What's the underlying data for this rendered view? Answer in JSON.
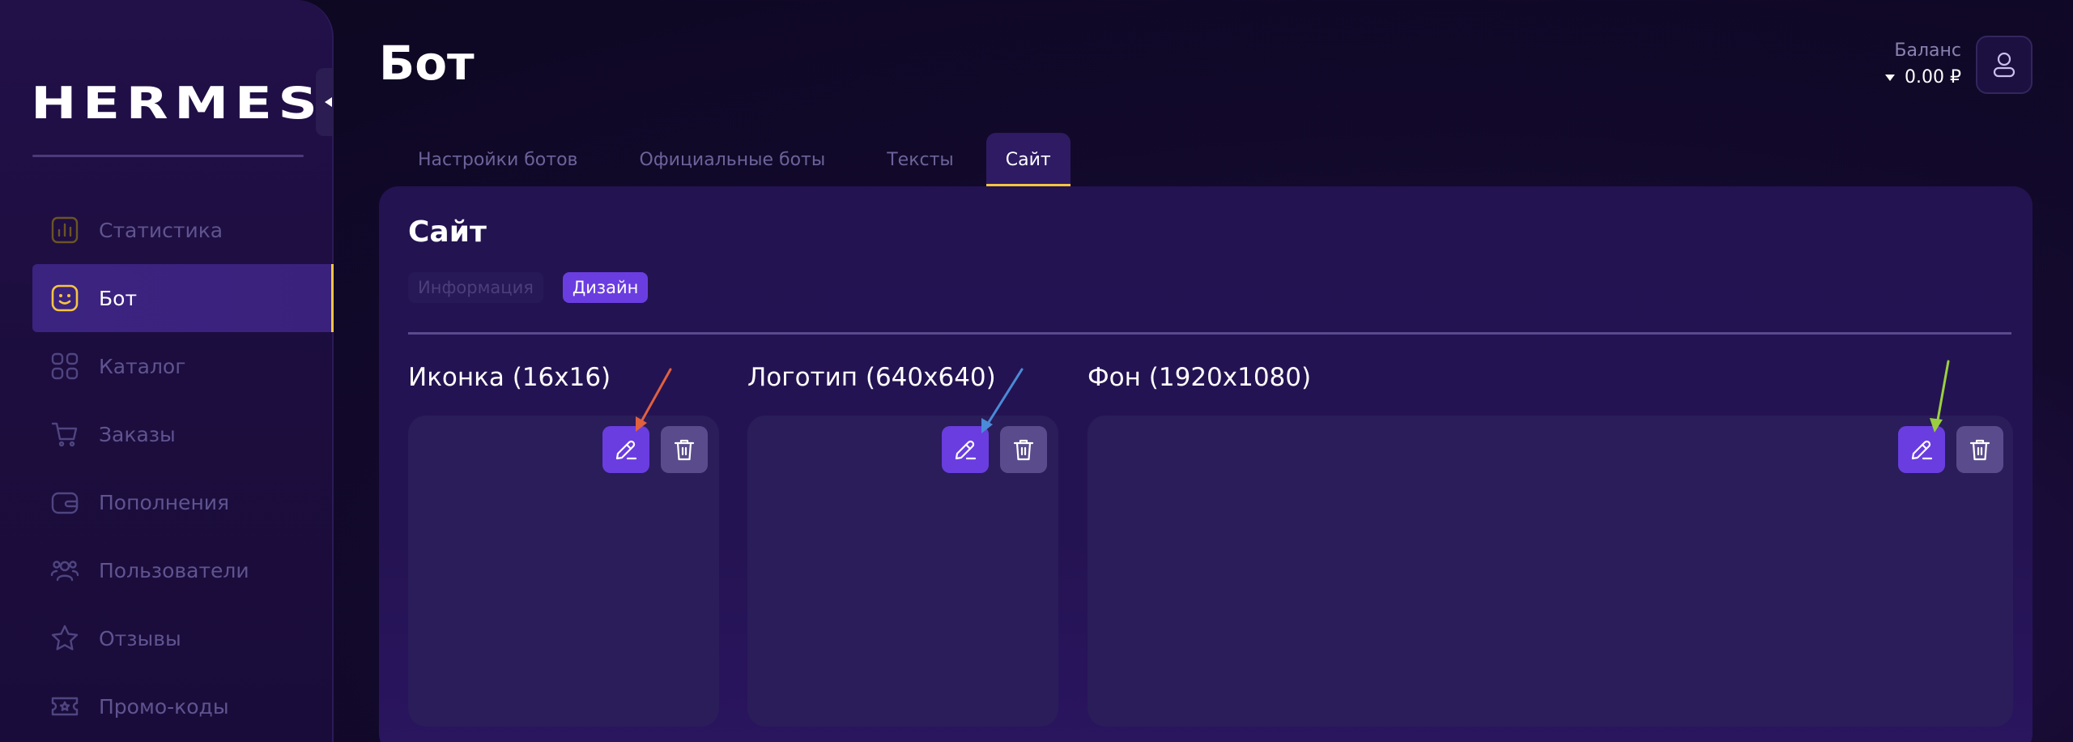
{
  "sidebar": {
    "logo": "HERMES",
    "items": [
      {
        "label": "Статистика",
        "icon": "chart-icon",
        "active": false
      },
      {
        "label": "Бот",
        "icon": "bot-face-icon",
        "active": true
      },
      {
        "label": "Каталог",
        "icon": "grid-icon",
        "active": false
      },
      {
        "label": "Заказы",
        "icon": "cart-icon",
        "active": false
      },
      {
        "label": "Пополнения",
        "icon": "wallet-icon",
        "active": false
      },
      {
        "label": "Пользователи",
        "icon": "users-icon",
        "active": false
      },
      {
        "label": "Отзывы",
        "icon": "star-icon",
        "active": false
      },
      {
        "label": "Промо-коды",
        "icon": "ticket-icon",
        "active": false
      }
    ]
  },
  "header": {
    "title": "Бот",
    "balance_label": "Баланс",
    "balance_value": "0.00 ₽"
  },
  "tabs": [
    {
      "label": "Настройки ботов",
      "active": false
    },
    {
      "label": "Официальные боты",
      "active": false
    },
    {
      "label": "Тексты",
      "active": false
    },
    {
      "label": "Сайт",
      "active": true
    }
  ],
  "card": {
    "title": "Сайт",
    "subtabs": [
      {
        "label": "Информация",
        "active": false
      },
      {
        "label": "Дизайн",
        "active": true
      }
    ],
    "sections": [
      {
        "label": "Иконка (16x16)"
      },
      {
        "label": "Логотип (640x640)"
      },
      {
        "label": "Фон (1920x1080)"
      }
    ]
  },
  "colors": {
    "accent": "#6a3de0",
    "highlight": "#f5c542",
    "arrow_red": "#e06040",
    "arrow_blue": "#4a8ad8",
    "arrow_green": "#9ad040"
  }
}
